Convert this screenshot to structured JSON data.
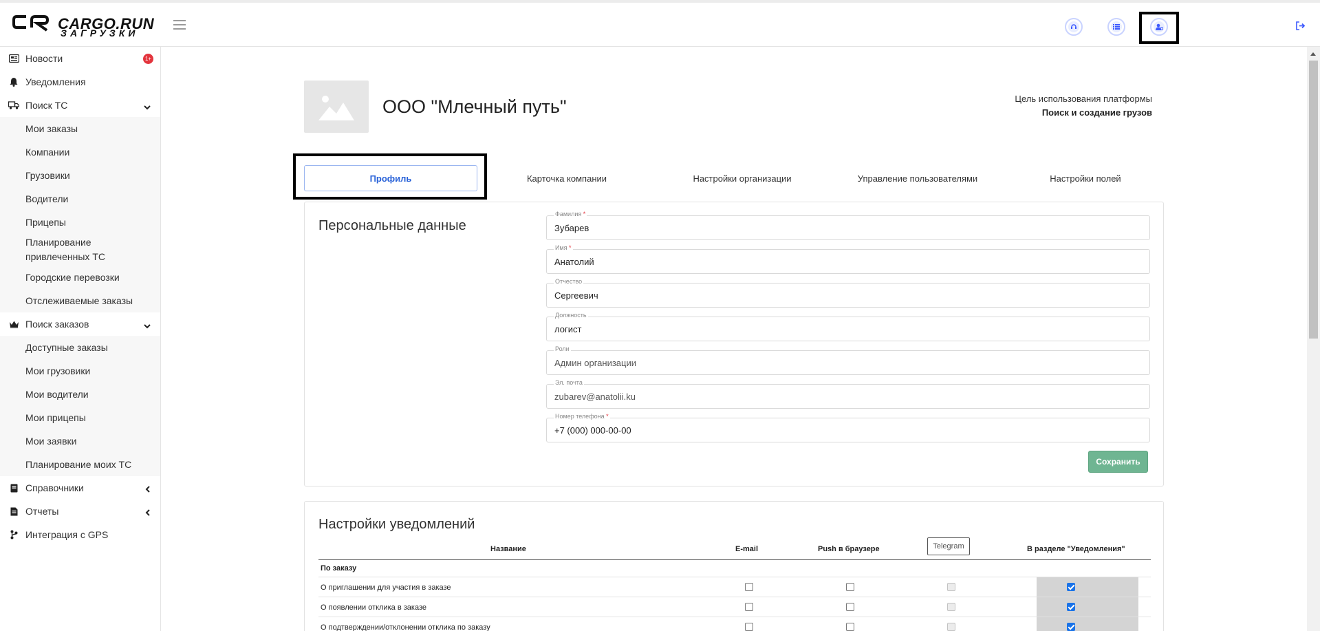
{
  "app": {
    "brand": "CARGO.RUN",
    "brand_sub": "ЗАГРУЗКИ"
  },
  "header": {
    "icons": [
      "support-icon",
      "list-icon",
      "user-settings-icon",
      "logout-icon"
    ]
  },
  "sidebar": {
    "items": [
      {
        "label": "Новости",
        "icon": "news-icon",
        "badge": "1+"
      },
      {
        "label": "Уведомления",
        "icon": "bell-icon"
      },
      {
        "label": "Поиск ТС",
        "icon": "truck-icon",
        "chevron": "down"
      },
      {
        "label": "Мои заказы"
      },
      {
        "label": "Компании"
      },
      {
        "label": "Грузовики"
      },
      {
        "label": "Водители"
      },
      {
        "label": "Прицепы"
      },
      {
        "label": "Планирование привлеченных ТС"
      },
      {
        "label": "Городские перевозки"
      },
      {
        "label": "Отслеживаемые заказы"
      },
      {
        "label": "Поиск заказов",
        "icon": "crown-icon",
        "chevron": "down"
      },
      {
        "label": "Доступные заказы"
      },
      {
        "label": "Мои грузовики"
      },
      {
        "label": "Мои водители"
      },
      {
        "label": "Мои прицепы"
      },
      {
        "label": "Мои заявки"
      },
      {
        "label": "Планирование моих ТС"
      },
      {
        "label": "Справочники",
        "icon": "book-icon",
        "chevron": "left"
      },
      {
        "label": "Отчеты",
        "icon": "report-icon",
        "chevron": "left"
      },
      {
        "label": "Интеграция с GPS",
        "icon": "gps-icon"
      }
    ]
  },
  "company": {
    "name": "ООО \"Млечный путь\"",
    "purpose_label": "Цель использования платформы",
    "purpose_value": "Поиск и создание грузов"
  },
  "tabs": [
    {
      "label": "Профиль",
      "active": true
    },
    {
      "label": "Карточка компании"
    },
    {
      "label": "Настройки организации"
    },
    {
      "label": "Управление пользователями"
    },
    {
      "label": "Настройки полей"
    }
  ],
  "personal": {
    "title": "Персональные данные",
    "fields": [
      {
        "label": "Фамилия",
        "required": "*",
        "value": "Зубарев"
      },
      {
        "label": "Имя",
        "required": "*",
        "value": "Анатолий"
      },
      {
        "label": "Отчество",
        "required": "",
        "value": "Сергеевич"
      },
      {
        "label": "Должность",
        "required": "",
        "value": "логист"
      },
      {
        "label": "Роли",
        "required": "",
        "value": "Админ организации"
      },
      {
        "label": "Эл. почта",
        "required": "",
        "value": "zubarev@anatolii.ku"
      },
      {
        "label": "Номер телефона",
        "required": "*",
        "value": "+7 (000) 000-00-00"
      }
    ],
    "save_label": "Сохранить"
  },
  "notifications": {
    "title": "Настройки уведомлений",
    "columns": {
      "name": "Название",
      "email": "E-mail",
      "push": "Push в браузере",
      "telegram": "Telegram",
      "section": "В разделе \"Уведомления\""
    },
    "group": "По заказу",
    "rows": [
      {
        "label": "О приглашении для участия в заказе",
        "email": false,
        "push": false,
        "telegram": false,
        "section": true
      },
      {
        "label": "О появлении отклика в заказе",
        "email": false,
        "push": false,
        "telegram": false,
        "section": true
      },
      {
        "label": "О подтверждении/отклонении отклика по заказу",
        "email": false,
        "push": false,
        "telegram": false,
        "section": true
      }
    ]
  }
}
